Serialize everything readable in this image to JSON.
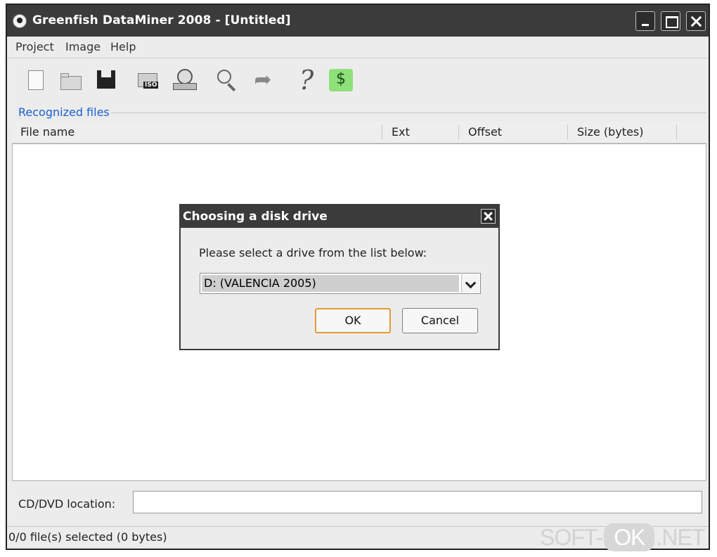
{
  "window": {
    "title": "Greenfish DataMiner 2008 - [Untitled]"
  },
  "menu": {
    "items": [
      "Project",
      "Image",
      "Help"
    ]
  },
  "toolbar": {
    "icons": [
      "new-document-icon",
      "open-folder-icon",
      "save-icon",
      "iso-image-icon",
      "disk-drive-icon",
      "search-icon",
      "redo-arrow-icon",
      "help-icon",
      "dollar-icon"
    ],
    "iso_label": "ISO",
    "help_glyph": "?",
    "dollar_glyph": "$"
  },
  "files_group": {
    "label": "Recognized files",
    "columns": [
      "File name",
      "Ext",
      "Offset",
      "Size (bytes)"
    ]
  },
  "location": {
    "label": "CD/DVD location:",
    "value": ""
  },
  "status": {
    "text": "0/0 file(s) selected (0 bytes)"
  },
  "dialog": {
    "title": "Choosing a disk drive",
    "prompt": "Please select a drive from the list below:",
    "selected_drive": "D: (VALENCIA 2005)",
    "ok_label": "OK",
    "cancel_label": "Cancel"
  },
  "watermark": {
    "left": "SOFT-",
    "mid": "OK",
    "right": ".NET"
  },
  "colors": {
    "titlebar": "#3b3b3b",
    "group_label": "#1a5fd0",
    "ok_focus": "#e39a3a",
    "dollar_bg": "#8ee07a"
  }
}
